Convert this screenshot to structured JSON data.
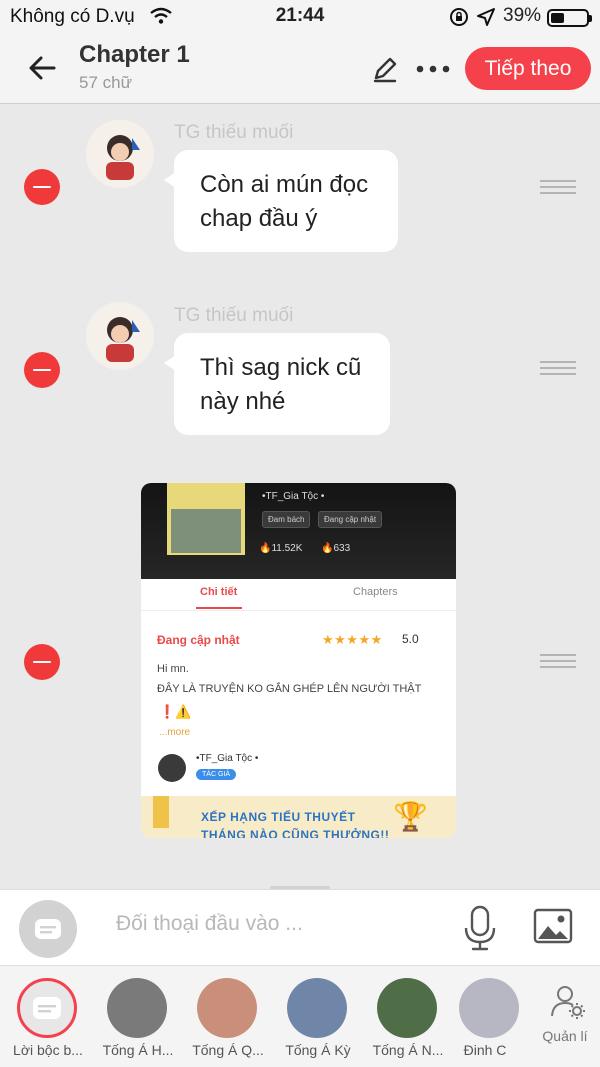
{
  "status_bar": {
    "carrier": "Không có D.vụ",
    "time": "21:44",
    "battery_percent": "39%",
    "battery_level": 0.39
  },
  "header": {
    "title": "Chapter 1",
    "subtitle": "57 chữ",
    "next_label": "Tiếp theo"
  },
  "messages": [
    {
      "sender": "TG thiếu muối",
      "text_line1": "Còn ai mún đọc",
      "text_line2": "chap đầu ý"
    },
    {
      "sender": "TG thiếu muối",
      "text_line1": "Thì sag nick cũ",
      "text_line2": "này nhé"
    }
  ],
  "card": {
    "author": "•TF_Gia Tộc •",
    "tags": [
      "Đam bách",
      "Đang cập nhật"
    ],
    "likes": "11.52K",
    "hearts": "633",
    "tabs": [
      "Chi tiết",
      "Chapters"
    ],
    "status": "Đang cập nhật",
    "stars": "★★★★★",
    "rating": "5.0",
    "desc_line1": "Hi mn.",
    "desc_line2": "ĐÂY LÀ TRUYỆN KO GẮN GHÉP LÊN NGƯỜI THẬT",
    "warn": "❗⚠️",
    "more": "...more",
    "author_badge": "TÁC GIẢ",
    "banner_line1": "XẾP HẠNG TIỂU THUYẾT",
    "banner_line2": "THÁNG NÀO CŨNG THƯỞNG!!"
  },
  "composer": {
    "placeholder": "Đối thoại đầu vào ..."
  },
  "characters": [
    {
      "label": "Lời bộc b...",
      "color": "#e7e7e7"
    },
    {
      "label": "Tống Á H...",
      "color": "#7a7a7a"
    },
    {
      "label": "Tống Á Q...",
      "color": "#c98f7a"
    },
    {
      "label": "Tống Á Kỳ",
      "color": "#6f86a8"
    },
    {
      "label": "Tống Á N...",
      "color": "#4f6e48"
    },
    {
      "label": "Đinh C",
      "color": "#b7b7c4"
    }
  ],
  "manage_label": "Quản lí",
  "colors": {
    "accent": "#f5414b",
    "remove": "#f03a3a"
  }
}
